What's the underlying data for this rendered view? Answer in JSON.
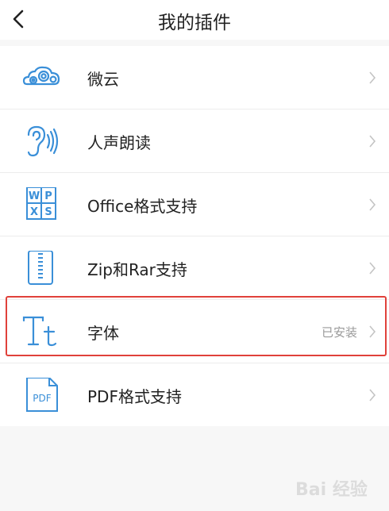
{
  "header": {
    "title": "我的插件"
  },
  "plugins": [
    {
      "label": "微云",
      "icon": "weiyun-cloud-icon",
      "status": ""
    },
    {
      "label": "人声朗读",
      "icon": "ear-voice-icon",
      "status": ""
    },
    {
      "label": "Office格式支持",
      "icon": "office-wpxs-icon",
      "status": ""
    },
    {
      "label": "Zip和Rar支持",
      "icon": "zip-archive-icon",
      "status": ""
    },
    {
      "label": "字体",
      "icon": "font-tt-icon",
      "status": "已安装"
    },
    {
      "label": "PDF格式支持",
      "icon": "pdf-file-icon",
      "status": ""
    }
  ],
  "office_icon_letters": [
    "W",
    "P",
    "X",
    "S"
  ],
  "font_icon_letters": "Tt",
  "pdf_icon_label": "PDF",
  "watermark": "Bai 经验",
  "colors": {
    "icon_blue": "#3a8fd8",
    "highlight_red": "#e0413a",
    "text": "#222222",
    "muted": "#9a9a9a"
  }
}
